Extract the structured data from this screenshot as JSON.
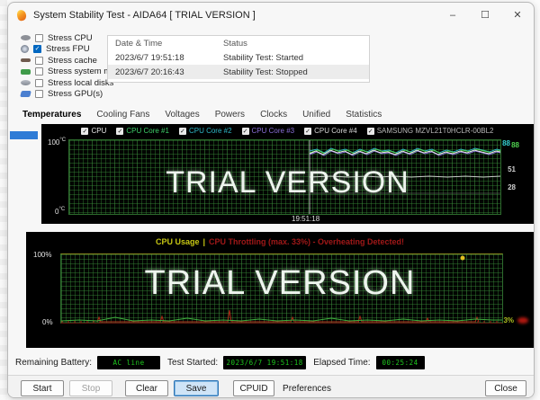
{
  "window": {
    "title": "System Stability Test - AIDA64  [ TRIAL VERSION ]",
    "controls": {
      "minimize": "–",
      "maximize": "☐",
      "close": "✕"
    }
  },
  "stress_options": {
    "items": [
      {
        "label": "Stress CPU",
        "checked": false,
        "icon": "cpu-icon"
      },
      {
        "label": "Stress FPU",
        "checked": true,
        "icon": "fpu-icon"
      },
      {
        "label": "Stress cache",
        "checked": false,
        "icon": "cache-icon"
      },
      {
        "label": "Stress system mem",
        "checked": false,
        "icon": "memory-icon"
      },
      {
        "label": "Stress local disks",
        "checked": false,
        "icon": "disk-icon"
      },
      {
        "label": "Stress GPU(s)",
        "checked": false,
        "icon": "gpu-icon"
      }
    ]
  },
  "log": {
    "columns": [
      "Date & Time",
      "Status"
    ],
    "rows": [
      [
        "2023/6/7 19:51:18",
        "Stability Test: Started"
      ],
      [
        "2023/6/7 20:16:43",
        "Stability Test: Stopped"
      ]
    ]
  },
  "tabs": {
    "selected": "Temperatures",
    "items": [
      "Temperatures",
      "Cooling Fans",
      "Voltages",
      "Powers",
      "Clocks",
      "Unified",
      "Statistics"
    ]
  },
  "temperature_graph": {
    "legend": [
      {
        "label": "CPU",
        "color": "#e6e6e6"
      },
      {
        "label": "CPU Core #1",
        "color": "#3ecf6a"
      },
      {
        "label": "CPU Core #2",
        "color": "#2fb8c8"
      },
      {
        "label": "CPU Core #3",
        "color": "#8a6fd8"
      },
      {
        "label": "CPU Core #4",
        "color": "#d8d8d8"
      },
      {
        "label": "SAMSUNG MZVL21T0HCLR-00BL2",
        "color": "#b8b8b8"
      }
    ],
    "y_top": "100",
    "y_bottom": "0",
    "y_unit": "°C",
    "time_marker": "19:51:18",
    "right_values": [
      {
        "text": "88",
        "color": "#35d0d0"
      },
      {
        "text": "88",
        "color": "#4fd04f"
      },
      {
        "text": "51",
        "color": "#cfcfcf"
      },
      {
        "text": "28",
        "color": "#cfcfcf"
      }
    ],
    "watermark": "TRIAL VERSION"
  },
  "usage_graph": {
    "title": "CPU Usage",
    "separator": "|",
    "warning": "CPU Throttling (max. 33%) - Overheating Detected!",
    "y_top": "100%",
    "y_bottom": "0%",
    "right_value": "3%",
    "watermark": "TRIAL VERSION"
  },
  "status_bar": {
    "battery_label": "Remaining Battery:",
    "battery_value": "AC line",
    "started_label": "Test Started:",
    "started_value": "2023/6/7 19:51:18",
    "elapsed_label": "Elapsed Time:",
    "elapsed_value": "00:25:24"
  },
  "buttons": {
    "start": "Start",
    "stop": "Stop",
    "clear": "Clear",
    "save": "Save",
    "cpuid": "CPUID",
    "preferences": "Preferences",
    "close": "Close"
  }
}
